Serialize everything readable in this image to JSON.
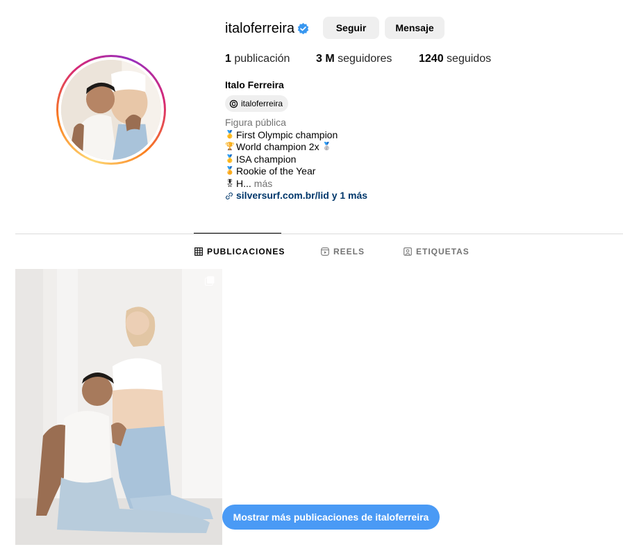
{
  "profile": {
    "username": "italoferreira",
    "verified": true,
    "follow_label": "Seguir",
    "message_label": "Mensaje",
    "stats": {
      "posts_value": "1",
      "posts_label": "publicación",
      "followers_value": "3 M",
      "followers_label": "seguidores",
      "following_value": "1240",
      "following_label": "seguidos"
    },
    "full_name": "Italo Ferreira",
    "threads_handle": "italoferreira",
    "bio": {
      "category": "Figura pública",
      "lines": [
        {
          "emoji": "🥇",
          "text": "First Olympic champion"
        },
        {
          "emoji": "🏆",
          "text": "World champion 2x",
          "suffix_emoji": "🥈"
        },
        {
          "emoji": "🥇",
          "text": "ISA champion"
        },
        {
          "emoji": "🏅",
          "text": "Rookie of the Year"
        },
        {
          "emoji": "🎖",
          "text": "H...",
          "more": "más"
        }
      ],
      "link": "silversurf.com.br/lid y 1 más"
    }
  },
  "tabs": [
    {
      "label": "PUBLICACIONES",
      "icon": "grid-icon",
      "active": true
    },
    {
      "label": "REELS",
      "icon": "reels-icon",
      "active": false
    },
    {
      "label": "ETIQUETAS",
      "icon": "tagged-icon",
      "active": false
    }
  ],
  "cta": {
    "label": "Mostrar más publicaciones de italoferreira"
  },
  "colors": {
    "accent": "#4a9af5",
    "verified": "#3897f0",
    "link": "#00376b",
    "muted": "#737373",
    "button_bg": "#efefef"
  }
}
